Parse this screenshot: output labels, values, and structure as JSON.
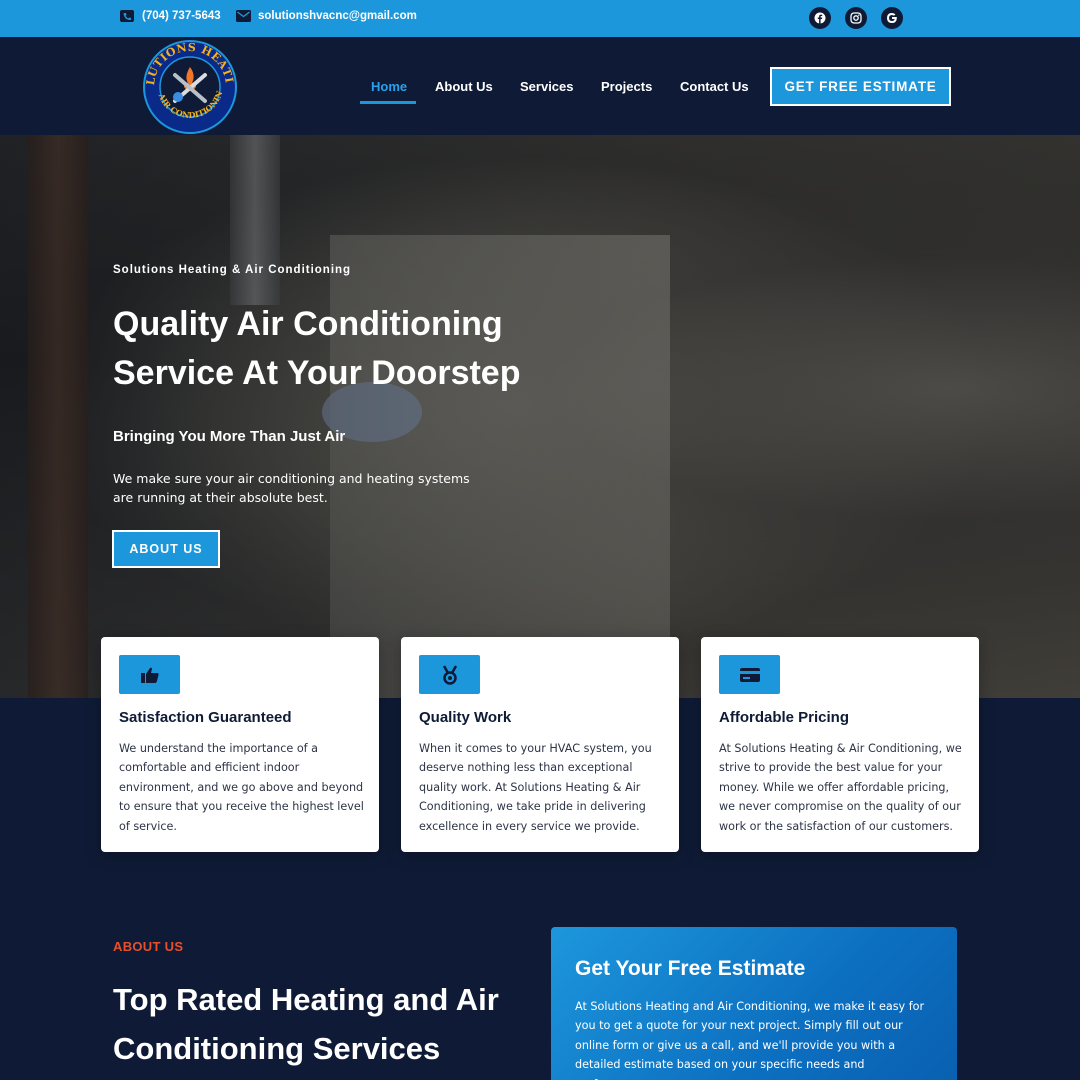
{
  "topbar": {
    "phone": "(704) 737-5643",
    "email": "solutionshvacnc@gmail.com",
    "social": [
      "facebook-icon",
      "instagram-icon",
      "google-icon"
    ]
  },
  "header": {
    "logo_text": "SOLUTIONS HEATING & AIR CONDITIONING",
    "nav": [
      {
        "label": "Home",
        "active": true
      },
      {
        "label": "About Us"
      },
      {
        "label": "Services"
      },
      {
        "label": "Projects"
      },
      {
        "label": "Contact Us"
      }
    ],
    "cta_label": "GET FREE ESTIMATE"
  },
  "hero": {
    "kicker": "Solutions Heating & Air Conditioning",
    "title": "Quality Air Conditioning Service At Your Doorstep",
    "subtitle": "Bringing You More Than Just Air",
    "description": "We make sure your air conditioning and heating systems are running at their absolute best.",
    "button_label": "ABOUT US"
  },
  "features": [
    {
      "icon": "thumbs-up-icon",
      "title": "Satisfaction Guaranteed",
      "text": "We understand the importance of a comfortable and efficient indoor environment, and we go above and beyond to ensure that you receive the highest level of service."
    },
    {
      "icon": "medal-icon",
      "title": "Quality Work",
      "text": "When it comes to your HVAC system, you deserve nothing less than exceptional quality work. At Solutions Heating & Air Conditioning, we take pride in delivering excellence in every service we provide."
    },
    {
      "icon": "credit-card-icon",
      "title": "Affordable Pricing",
      "text": "At Solutions Heating & Air Conditioning, we strive to provide the best value for your money. While we offer affordable pricing, we never compromise on the quality of our work or the satisfaction of our customers."
    }
  ],
  "about": {
    "kicker": "ABOUT US",
    "title": "Top Rated Heating and Air Conditioning Services"
  },
  "estimate": {
    "title": "Get Your Free Estimate",
    "text": "At Solutions Heating and Air Conditioning, we make it easy for you to get a quote for your next project. Simply fill out our online form or give us a call, and we'll provide you with a detailed estimate based on your specific needs and preferences."
  },
  "colors": {
    "accent": "#1d97dc",
    "navy": "#0f1b36",
    "orange": "#e8502a"
  }
}
